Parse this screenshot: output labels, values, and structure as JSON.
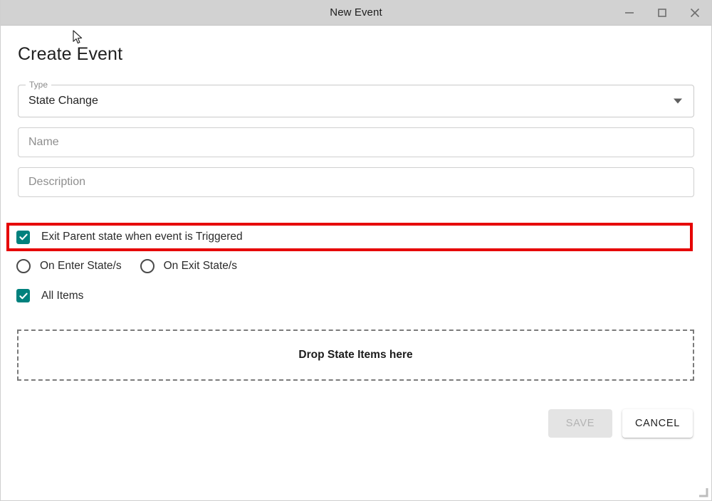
{
  "window": {
    "title": "New Event",
    "controls": [
      {
        "name": "minimize",
        "icon": "minimize-icon"
      },
      {
        "name": "maximize",
        "icon": "maximize-icon"
      },
      {
        "name": "close",
        "icon": "close-icon"
      }
    ]
  },
  "dialog": {
    "heading": "Create Event",
    "type_field": {
      "label": "Type",
      "value": "State Change",
      "icon": "chevron-down-icon"
    },
    "name_field": {
      "value": "",
      "placeholder": "Name"
    },
    "description_field": {
      "value": "",
      "placeholder": "Description"
    },
    "exit_parent_checkbox": {
      "label": "Exit Parent state when event is Triggered",
      "checked": true,
      "highlighted": true
    },
    "radios": [
      {
        "label": "On Enter State/s",
        "selected": false
      },
      {
        "label": "On Exit State/s",
        "selected": false
      }
    ],
    "all_items_checkbox": {
      "label": "All Items",
      "checked": true
    },
    "dropzone": {
      "text": "Drop State Items here"
    },
    "buttons": {
      "save": {
        "label": "SAVE",
        "disabled": true
      },
      "cancel": {
        "label": "CANCEL",
        "disabled": false
      }
    }
  },
  "colors": {
    "accent_teal": "#00817d",
    "highlight_red": "#e60000",
    "titlebar_bg": "#d2d2d2",
    "disabled_button_bg": "#e4e4e4",
    "disabled_button_text": "#b3b3b3"
  }
}
